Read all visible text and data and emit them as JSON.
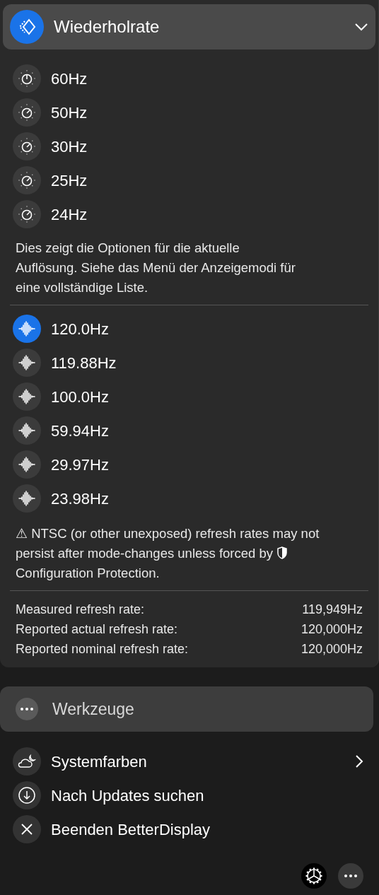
{
  "header": {
    "title": "Wiederholrate",
    "expanded": true
  },
  "rates": [
    {
      "label": "60Hz",
      "kind": "upright"
    },
    {
      "label": "50Hz",
      "kind": "tilted"
    },
    {
      "label": "30Hz",
      "kind": "tilted"
    },
    {
      "label": "25Hz",
      "kind": "tilted"
    },
    {
      "label": "24Hz",
      "kind": "tilted"
    }
  ],
  "rates_note": "Dies zeigt die Optionen für die aktuelle Auflösung. Siehe das Menü der Anzeigemodi für eine vollständige Liste.",
  "modes": [
    {
      "label": "120.0Hz",
      "selected": true
    },
    {
      "label": "119.88Hz",
      "selected": false
    },
    {
      "label": "100.0Hz",
      "selected": false
    },
    {
      "label": "59.94Hz",
      "selected": false
    },
    {
      "label": "29.97Hz",
      "selected": false
    },
    {
      "label": "23.98Hz",
      "selected": false
    }
  ],
  "warning": {
    "text": "⚠ NTSC (or other unexposed) refresh rates may not persist after mode-changes unless forced by",
    "link": "Configuration Protection."
  },
  "measurements": [
    {
      "label": "Measured refresh rate:",
      "value": "119,949Hz"
    },
    {
      "label": "Reported actual refresh rate:",
      "value": "120,000Hz"
    },
    {
      "label": "Reported nominal refresh rate:",
      "value": "120,000Hz"
    }
  ],
  "tools": {
    "title": "Werkzeuge",
    "items": [
      {
        "label": "Systemfarben",
        "kind": "weather",
        "submenu": true
      },
      {
        "label": "Nach Updates suchen",
        "kind": "download",
        "submenu": false
      },
      {
        "label": "Beenden BetterDisplay",
        "kind": "quit",
        "submenu": false
      }
    ]
  }
}
